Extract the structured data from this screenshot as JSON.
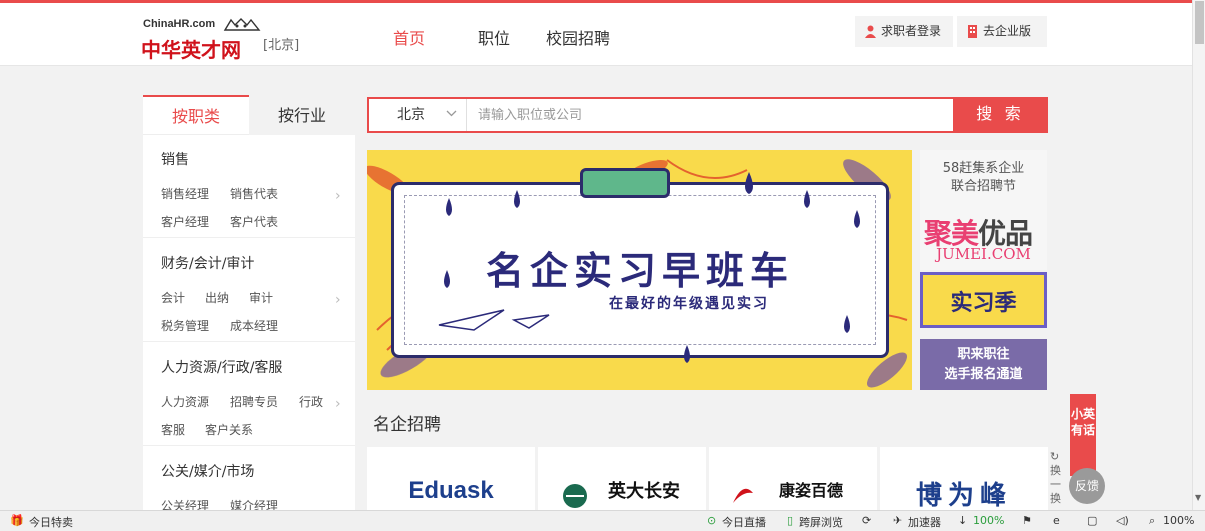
{
  "header": {
    "logo_en": "ChinaHR.com",
    "logo_cn": "中华英才网",
    "city": "[北京]",
    "nav": [
      "首页",
      "职位",
      "校园招聘"
    ],
    "login": "求职者登录",
    "enterprise": "去企业版"
  },
  "sidebar": {
    "tabs": [
      "按职类",
      "按行业"
    ],
    "categories": [
      {
        "title": "销售",
        "row1": [
          "销售经理",
          "销售代表"
        ],
        "row2": [
          "客户经理",
          "客户代表"
        ]
      },
      {
        "title": "财务/会计/审计",
        "row1": [
          "会计",
          "出纳",
          "审计"
        ],
        "row2": [
          "税务管理",
          "成本经理"
        ]
      },
      {
        "title": "人力资源/行政/客服",
        "row1": [
          "人力资源",
          "招聘专员",
          "行政"
        ],
        "row2": [
          "客服",
          "客户关系"
        ]
      },
      {
        "title": "公关/媒介/市场",
        "row1": [
          "公关经理",
          "媒介经理"
        ],
        "row2": []
      }
    ]
  },
  "search": {
    "city": "北京",
    "placeholder": "请输入职位或公司",
    "button": "搜 索"
  },
  "banner": {
    "title": "名企实习早班车",
    "subtitle": "在最好的年级遇见实习"
  },
  "ads": {
    "ad1_line1": "58赶集系企业",
    "ad1_line2": "联合招聘节",
    "ad1_brand_a": "聚美",
    "ad1_brand_b": "优品",
    "ad1_domain": "JUMEI.COM",
    "ad2": "实习季",
    "ad3_line1": "职来职往",
    "ad3_line2": "选手报名通道"
  },
  "section": {
    "title": "名企招聘",
    "companies": [
      "Eduask",
      "英大长安",
      "康姿百德",
      "博为峰"
    ]
  },
  "floating": {
    "xiaoying": "小英有话",
    "huan": "换一换",
    "feedback": "反馈"
  },
  "statusbar": {
    "left": "今日特卖",
    "live": "今日直播",
    "cross": "跨屏浏览",
    "accel": "加速器",
    "download": "100%",
    "zoom": "100%"
  },
  "colors": {
    "accent": "#e94b4b",
    "banner_yellow": "#f9da4b",
    "navy": "#2b2a7a"
  }
}
